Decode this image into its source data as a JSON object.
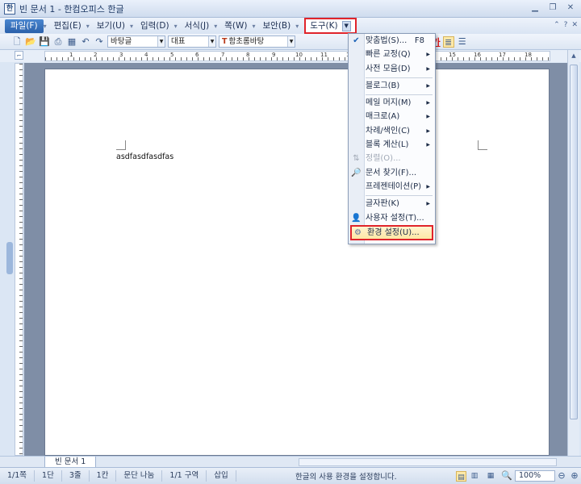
{
  "window": {
    "title": "빈 문서 1 - 한컴오피스 한글",
    "app_icon": "hwp-app-icon",
    "buttons": [
      "minimize-icon",
      "restore-icon",
      "close-icon"
    ]
  },
  "menu": {
    "items": [
      {
        "label": "파일(F)",
        "key": "file"
      },
      {
        "label": "편집(E)",
        "key": "edit"
      },
      {
        "label": "보기(U)",
        "key": "view"
      },
      {
        "label": "입력(D)",
        "key": "input"
      },
      {
        "label": "서식(J)",
        "key": "format"
      },
      {
        "label": "쪽(W)",
        "key": "page"
      },
      {
        "label": "보안(B)",
        "key": "security"
      }
    ],
    "active": {
      "label": "도구(K)",
      "key": "tools"
    }
  },
  "toolbar": {
    "style_combo": "바탕글",
    "lang_combo": "대표",
    "font_combo": "함초롬바탕",
    "font_prefix": "T",
    "format_buttons": [
      "가",
      "가",
      "가",
      "가",
      "가"
    ]
  },
  "ruler": {
    "numbers": [
      "1",
      "2",
      "3",
      "4",
      "5",
      "6",
      "7",
      "8",
      "9",
      "10",
      "11",
      "12",
      "13",
      "14",
      "15",
      "16",
      "17",
      "18"
    ]
  },
  "document": {
    "text": "asdfasdfasdfas"
  },
  "tab": {
    "label": "빈 문서 1"
  },
  "status": {
    "page": "1/1쪽",
    "column": "1단",
    "line": "3줄",
    "col": "1칸",
    "paragraph": "문단 나눔",
    "section": "1/1 구역",
    "mode": "삽입",
    "message": "한글의 사용 환경을 설정합니다.",
    "zoom": "100%"
  },
  "tools_menu": {
    "items": [
      {
        "label": "맞춤법(S)...",
        "shortcut": "F8",
        "icon": "spellcheck-icon"
      },
      {
        "label": "빠른 교정(Q)",
        "submenu": true
      },
      {
        "label": "사전 모음(D)",
        "submenu": true
      },
      {
        "separator": true
      },
      {
        "label": "블로그(B)",
        "submenu": true
      },
      {
        "separator": true
      },
      {
        "label": "메일 머지(M)",
        "submenu": true
      },
      {
        "label": "매크로(A)",
        "submenu": true
      },
      {
        "label": "차례/색인(C)",
        "submenu": true
      },
      {
        "label": "블록 계산(L)",
        "submenu": true
      },
      {
        "label": "정렬(O)...",
        "disabled": true,
        "icon": "sort-icon"
      },
      {
        "label": "문서 찾기(F)...",
        "icon": "find-document-icon"
      },
      {
        "label": "프레젠테이션(P)",
        "submenu": true
      },
      {
        "separator": true
      },
      {
        "label": "글자판(K)",
        "submenu": true
      },
      {
        "label": "사용자 설정(T)...",
        "icon": "user-settings-icon"
      },
      {
        "label": "환경 설정(U)...",
        "icon": "preferences-icon",
        "highlighted": true
      }
    ]
  }
}
